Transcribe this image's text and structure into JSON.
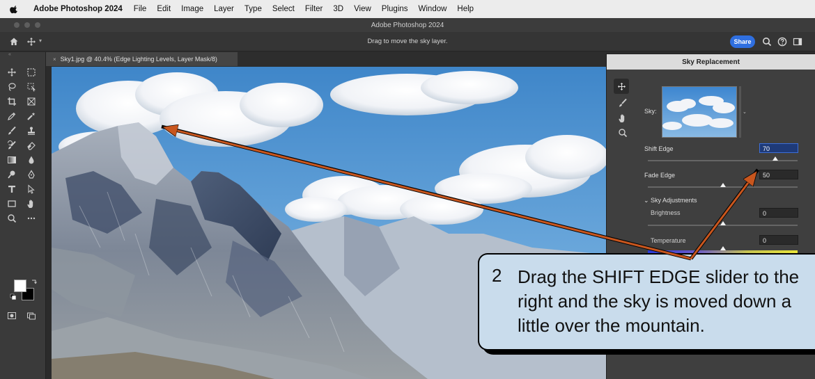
{
  "menubar": {
    "app_name": "Adobe Photoshop 2024",
    "items": [
      "File",
      "Edit",
      "Image",
      "Layer",
      "Type",
      "Select",
      "Filter",
      "3D",
      "View",
      "Plugins",
      "Window",
      "Help"
    ]
  },
  "window": {
    "title": "Adobe Photoshop 2024"
  },
  "options_bar": {
    "hint": "Drag to move the sky layer.",
    "share_label": "Share"
  },
  "document": {
    "tab_title": "Sky1.jpg @ 40.4% (Edge Lighting Levels, Layer Mask/8)",
    "close_glyph": "×"
  },
  "sky_panel": {
    "title": "Sky Replacement",
    "sky_label": "Sky:",
    "shift_edge": {
      "label": "Shift Edge",
      "value": "70",
      "fraction": 0.85
    },
    "fade_edge": {
      "label": "Fade Edge",
      "value": "50",
      "fraction": 0.5
    },
    "sky_adjustments_label": "Sky Adjustments",
    "brightness": {
      "label": "Brightness",
      "value": "0",
      "fraction": 0.5
    },
    "temperature": {
      "label": "Temperature",
      "value": "0",
      "fraction": 0.5
    }
  },
  "callout": {
    "number": "2",
    "text": "Drag the SHIFT EDGE slider to the\nright and the sky is moved down a\nlittle over the mountain."
  },
  "colors": {
    "accent_blue": "#2f6fe0",
    "arrow": "#c8561e",
    "callout_bg": "#c9dcec",
    "panel_bg": "#3f3f3f"
  }
}
